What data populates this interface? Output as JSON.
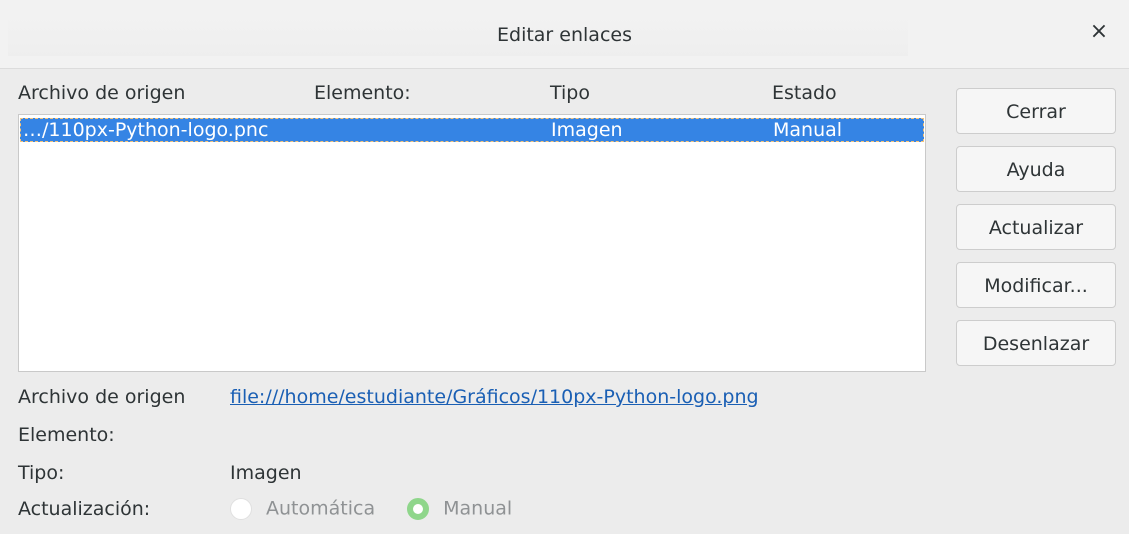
{
  "dialog": {
    "title": "Editar enlaces",
    "close_glyph": "×"
  },
  "columns": {
    "source": "Archivo de origen",
    "element": "Elemento:",
    "type": "Tipo",
    "status": "Estado"
  },
  "links": [
    {
      "source": "…/110px-Python-logo.pnc",
      "element": "",
      "type": "Imagen",
      "status": "Manual",
      "selected": true
    }
  ],
  "buttons": {
    "close": "Cerrar",
    "help": "Ayuda",
    "update": "Actualizar",
    "modify": "Modificar...",
    "unlink": "Desenlazar"
  },
  "details": {
    "source_label": "Archivo de origen",
    "source_value": "file:///home/estudiante/Gráficos/110px-Python-logo.png",
    "element_label": "Elemento:",
    "type_label": "Tipo:",
    "type_value": "Imagen",
    "update_label": "Actualización:",
    "update_options": [
      {
        "label": "Automática",
        "selected": false,
        "enabled": false
      },
      {
        "label": "Manual",
        "selected": true,
        "enabled": false
      }
    ]
  },
  "colors": {
    "selection": "#3584e4",
    "link": "#1a5fb4",
    "radio_selected": "#8fd68b"
  }
}
